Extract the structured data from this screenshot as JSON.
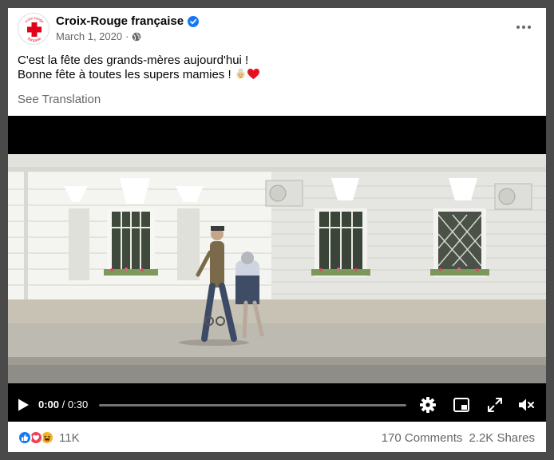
{
  "post": {
    "page_name": "Croix-Rouge française",
    "date": "March 1, 2020",
    "date_separator": "·",
    "audience_icon": "globe-icon",
    "text_line1": "C'est la fête des grands-mères aujourd'hui !",
    "text_line2": "Bonne fête à toutes les supers mamies ! ",
    "emojis": [
      "older-woman-emoji",
      "red-heart-emoji"
    ],
    "see_translation": "See Translation",
    "avatar_text_top": "croix-rouge",
    "avatar_text_bottom": "française"
  },
  "video": {
    "current_time": "0:00",
    "separator": " / ",
    "duration": "0:30",
    "progress": 0,
    "controls": [
      "play-icon",
      "settings-gear-icon",
      "picture-in-picture-icon",
      "fullscreen-icon",
      "volume-muted-icon"
    ]
  },
  "footer": {
    "reactions": [
      "like-icon",
      "love-icon",
      "haha-icon"
    ],
    "reaction_count": "11K",
    "comments": "170 Comments",
    "shares": "2.2K Shares"
  },
  "colors": {
    "brand_red": "#e3001b",
    "verified_blue": "#1877f2",
    "secondary_text": "#65676b",
    "background": "#4a4a4a"
  }
}
